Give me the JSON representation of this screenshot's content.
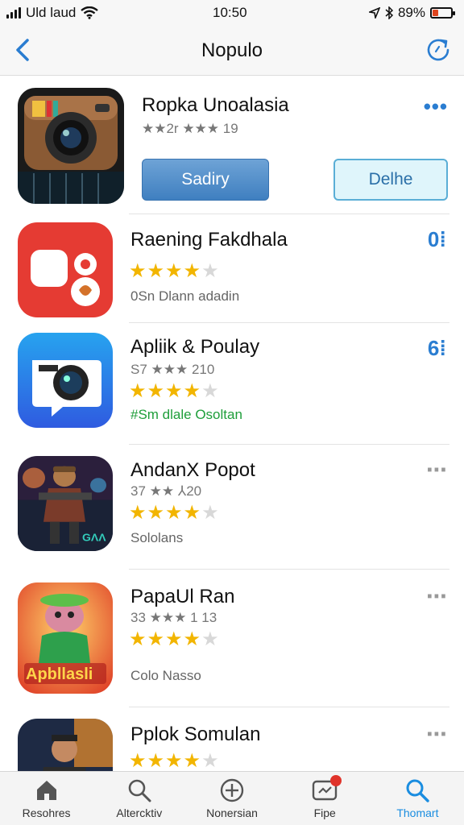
{
  "status_bar": {
    "carrier": "Uld laud",
    "time": "10:50",
    "battery_percent": "89%",
    "battery_level": 0.3,
    "icons": [
      "signal-icon",
      "wifi-icon",
      "location-icon",
      "bluetooth-icon",
      "battery-icon"
    ]
  },
  "nav": {
    "title": "Nopulo",
    "back_icon": "chevron-left-icon",
    "refresh_icon": "refresh-icon"
  },
  "apps": [
    {
      "name": "Ropka Unoalasia",
      "rating_text": "★★2r ★★★ 19",
      "rating": 2,
      "primary_button": "Sadiry",
      "secondary_button": "Delhe",
      "more": "•••"
    },
    {
      "name": "Raening Fakdhala",
      "rating": 4.5,
      "subtitle": "0Sn Dlann adadin",
      "badge": "0⁞"
    },
    {
      "name": "Apliik & Poulay",
      "rating_text": "S7 ★★★ 210",
      "rating": 4,
      "subtitle": "#Sm dlale Osoltan",
      "subtitle_color": "#1e9e3a",
      "badge": "6⁞"
    },
    {
      "name": "Andan⁠X Popot",
      "rating_text": "37 ★★ ⅄20",
      "rating": 4.5,
      "subtitle": "Sololans",
      "more": "⋯"
    },
    {
      "name": "PapaUl Ran",
      "rating_text": "33 ★★★ 1 13",
      "rating": 4,
      "subtitle": "Colo Nasso",
      "more": "⋯"
    },
    {
      "name": "Pplok Somulan",
      "rating": 4,
      "more": "⋯"
    }
  ],
  "tabs": [
    {
      "label": "Resohres",
      "icon": "home-icon"
    },
    {
      "label": "Altercktiv",
      "icon": "search-icon"
    },
    {
      "label": "Nonersian",
      "icon": "add-circle-icon"
    },
    {
      "label": "Fipe",
      "icon": "updates-icon",
      "badge": true
    },
    {
      "label": "Thomart",
      "icon": "search-icon",
      "active": true
    }
  ],
  "colors": {
    "accent": "#2a7dd1",
    "active_tab": "#1a8de0",
    "star": "#f2b500",
    "green_text": "#1e9e3a"
  }
}
